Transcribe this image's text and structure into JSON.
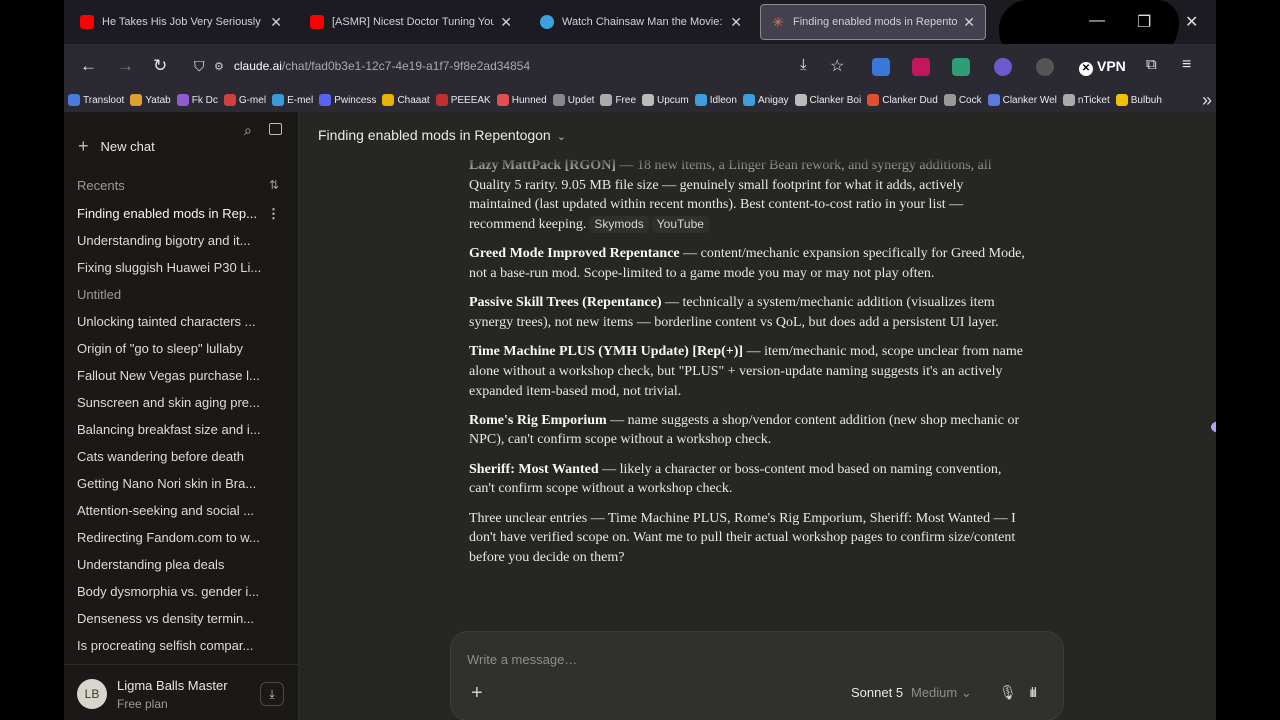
{
  "browser": {
    "tabs": [
      {
        "title": "He Takes His Job Very Seriously - YouT",
        "favicon": "youtube-icon"
      },
      {
        "title": "[ASMR] Nicest Doctor Tuning You To S",
        "favicon": "youtube-icon"
      },
      {
        "title": "Watch Chainsaw Man the Movie: Reze",
        "favicon": "globe-icon"
      },
      {
        "title": "Finding enabled mods in Repentogon",
        "favicon": "claude-icon",
        "active": true
      }
    ],
    "url_host": "claude.ai",
    "url_path": "/chat/fad0b3e1-12c7-4e19-a1f7-9f8e2ad34854",
    "vpn_label": "VPN",
    "bookmarks": [
      "Transloot",
      "Yatab",
      "Fk Dc",
      "G-mel",
      "E-mel",
      "Pwincess",
      "Chaaat",
      "PEEEAK",
      "Hunned",
      "Updet",
      "Free",
      "Upcum",
      "Idleon",
      "Anigay",
      "Clanker Boi",
      "Clanker Dud",
      "Cock",
      "Clanker Wel",
      "nTicket",
      "Bulbuh"
    ]
  },
  "sidebar": {
    "new_chat": "New chat",
    "recents_label": "Recents",
    "chats": [
      {
        "title": "Finding enabled mods in Rep...",
        "state": "active"
      },
      {
        "title": "Understanding bigotry and it..."
      },
      {
        "title": "Fixing sluggish Huawei P30 Li..."
      },
      {
        "title": "Untitled",
        "state": "muted"
      },
      {
        "title": "Unlocking tainted characters ..."
      },
      {
        "title": "Origin of \"go to sleep\" lullaby"
      },
      {
        "title": "Fallout New Vegas purchase l..."
      },
      {
        "title": "Sunscreen and skin aging pre..."
      },
      {
        "title": "Balancing breakfast size and i..."
      },
      {
        "title": "Cats wandering before death"
      },
      {
        "title": "Getting Nano Nori skin in Bra..."
      },
      {
        "title": "Attention-seeking and social ..."
      },
      {
        "title": "Redirecting Fandom.com to w..."
      },
      {
        "title": "Understanding plea deals"
      },
      {
        "title": "Body dysmorphia vs. gender i..."
      },
      {
        "title": "Denseness vs density termin..."
      },
      {
        "title": "Is procreating selfish compar..."
      }
    ],
    "user": {
      "initials": "LB",
      "name": "Ligma Balls Master",
      "plan": "Free plan"
    }
  },
  "conversation": {
    "title": "Finding enabled mods in Repentogon",
    "paragraphs": [
      {
        "bold": "Lazy MattPack [RGON]",
        "text": " — 18 new items, a Linger Bean rework, and synergy additions, all Quality 5 rarity. 9.05 MB file size — genuinely small footprint for what it adds, actively maintained (last updated within recent months). Best content-to-cost ratio in your list — recommend keeping.",
        "chips": [
          "Skymods",
          "YouTube"
        ]
      },
      {
        "bold": "Greed Mode Improved Repentance",
        "text": " — content/mechanic expansion specifically for Greed Mode, not a base-run mod. Scope-limited to a game mode you may or may not play often."
      },
      {
        "bold": "Passive Skill Trees (Repentance)",
        "text": " — technically a system/mechanic addition (visualizes item synergy trees), not new items — borderline content vs QoL, but does add a persistent UI layer."
      },
      {
        "bold": "Time Machine PLUS (YMH Update) [Rep(+)]",
        "text": " — item/mechanic mod, scope unclear from name alone without a workshop check, but \"PLUS\" + version-update naming suggests it's an actively expanded item-based mod, not trivial."
      },
      {
        "bold": "Rome's Rig Emporium",
        "text": " — name suggests a shop/vendor content addition (new shop mechanic or NPC), can't confirm scope without a workshop check."
      },
      {
        "bold": "Sheriff: Most Wanted",
        "text": " — likely a character or boss-content mod based on naming convention, can't confirm scope without a workshop check."
      },
      {
        "bold": "",
        "text": "Three unclear entries — Time Machine PLUS, Rome's Rig Emporium, Sheriff: Most Wanted — I don't have verified scope on. Want me to pull their actual workshop pages to confirm size/content before you decide on them?"
      }
    ]
  },
  "composer": {
    "placeholder": "Write a message…",
    "model": "Sonnet 5",
    "effort": "Medium"
  },
  "colors": {
    "sidebar_bg": "#1a1918",
    "main_bg": "#262624",
    "accent_claude": "#d97757",
    "tab_active_bg": "#42414d"
  }
}
